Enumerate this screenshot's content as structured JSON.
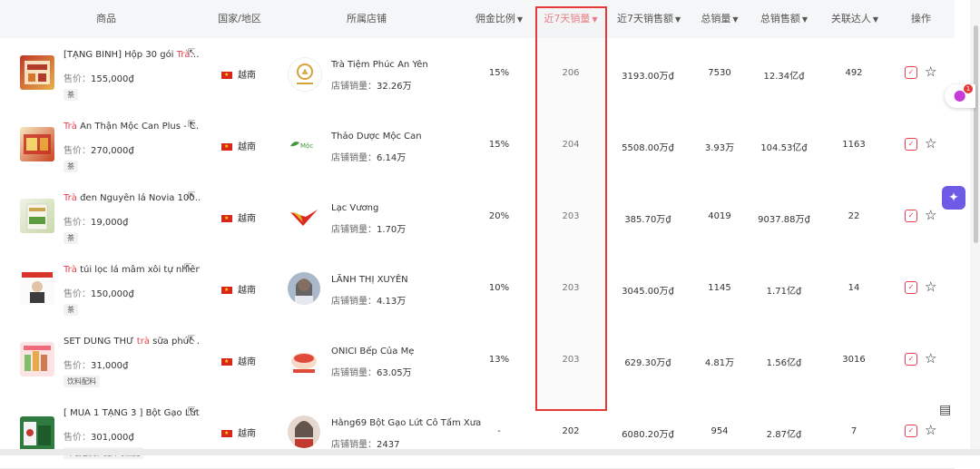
{
  "columns": {
    "product": "商品",
    "country": "国家/地区",
    "store": "所属店铺",
    "commission": "佣金比例",
    "sales7d": "近7天销量",
    "revenue7d": "近7天销售额",
    "total_sales": "总销量",
    "total_revenue": "总销售额",
    "influencers": "关联达人",
    "actions": "操作"
  },
  "price_label": "售价：",
  "store_sales_label": "店铺销量：",
  "rows": [
    {
      "name_prefix": "[TẶNG BÌNH] Hộp 30 gói ",
      "name_hl": "Trà",
      "name_suffix": "…",
      "price": "155,000₫",
      "tag": "茶",
      "country": "越南",
      "store": "Trà Tiệm Phúc An Yên",
      "store_sales": "32.26万",
      "commission": "15%",
      "sales7d": "206",
      "revenue7d": "3193.00万₫",
      "total_sales": "7530",
      "total_revenue": "12.34亿₫",
      "influencers": "492"
    },
    {
      "name_prefix": "",
      "name_hl": "Trà",
      "name_suffix": " An Thận Mộc Can Plus - C…",
      "price": "270,000₫",
      "tag": "茶",
      "country": "越南",
      "store": "Thảo Dược Mộc Can",
      "store_sales": "6.14万",
      "commission": "15%",
      "sales7d": "204",
      "revenue7d": "5508.00万₫",
      "total_sales": "3.93万",
      "total_revenue": "104.53亿₫",
      "influencers": "1163"
    },
    {
      "name_prefix": "",
      "name_hl": "Trà",
      "name_suffix": " đen Nguyên lá Novia 100…",
      "price": "19,000₫",
      "tag": "茶",
      "country": "越南",
      "store": "Lạc Vương",
      "store_sales": "1.70万",
      "commission": "20%",
      "sales7d": "203",
      "revenue7d": "385.70万₫",
      "total_sales": "4019",
      "total_revenue": "9037.88万₫",
      "influencers": "22"
    },
    {
      "name_prefix": "",
      "name_hl": "Trà",
      "name_suffix": " túi lọc lá mâm xôi tự nhiên",
      "price": "150,000₫",
      "tag": "茶",
      "country": "越南",
      "store": "LÃNH THỊ XUYÊN",
      "store_sales": "4.13万",
      "commission": "10%",
      "sales7d": "203",
      "revenue7d": "3045.00万₫",
      "total_sales": "1145",
      "total_revenue": "1.71亿₫",
      "influencers": "14"
    },
    {
      "name_prefix": "SET DÙNG THỬ ",
      "name_hl": "trà",
      "name_suffix": " sữa phúc …",
      "price": "31,000₫",
      "tag": "饮料配料",
      "country": "越南",
      "store": "ONICI Bếp Của Mẹ",
      "store_sales": "63.05万",
      "commission": "13%",
      "sales7d": "203",
      "revenue7d": "629.30万₫",
      "total_sales": "4.81万",
      "total_revenue": "1.56亿₫",
      "influencers": "3016"
    },
    {
      "name_prefix": "[ MUA 1 TẶNG 3 ] Bột Gạo Lứt…",
      "name_hl": "",
      "name_suffix": "",
      "price": "301,000₫",
      "tag": "早餐谷类、麦片与燕麦",
      "country": "越南",
      "store": "Hằng69 Bột Gạo Lứt Cô Tấm Xưa",
      "store_sales": "2437",
      "commission": "-",
      "sales7d": "202",
      "revenue7d": "6080.20万₫",
      "total_sales": "954",
      "total_revenue": "2.87亿₫",
      "influencers": "7"
    }
  ],
  "float_badge": "1",
  "colors": {
    "accent": "#e5404f",
    "highlight_border": "#e53935",
    "purple": "#6d5be6"
  },
  "icons": [
    "sort-arrow-icon",
    "external-link-icon",
    "vietnam-flag-icon",
    "add-icon",
    "star-icon",
    "map-pin-icon",
    "assistant-icon",
    "document-icon"
  ]
}
